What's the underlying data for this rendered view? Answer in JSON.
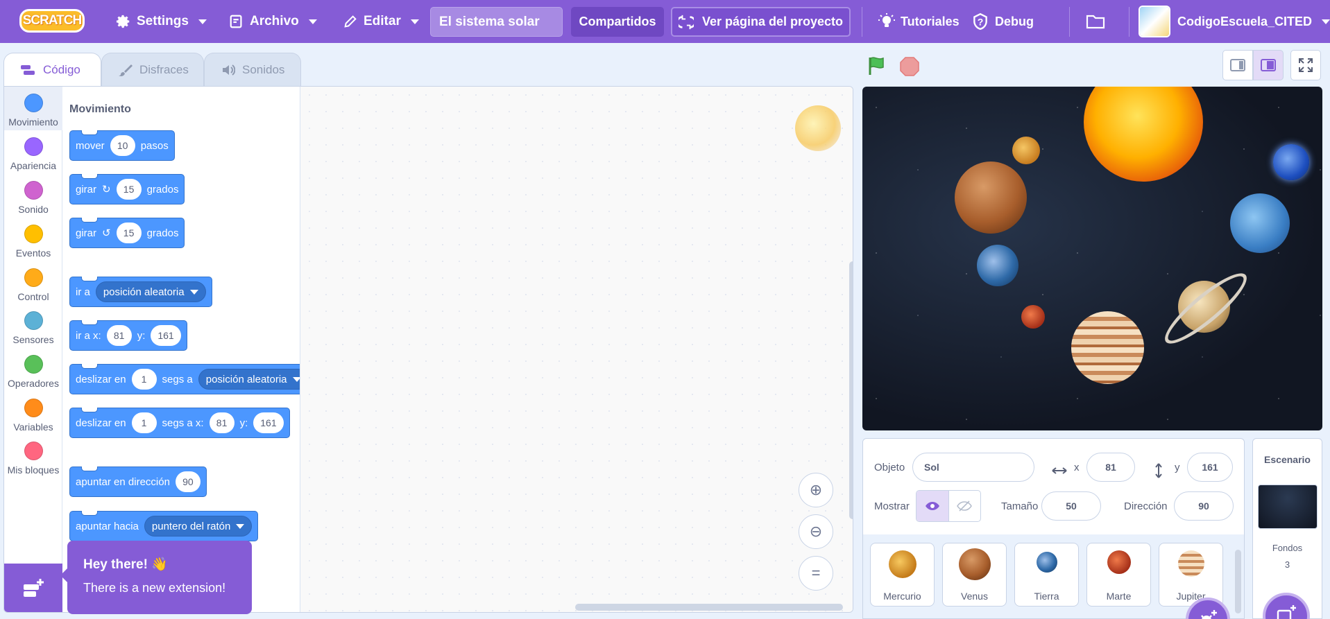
{
  "menu": {
    "logo": "SCRATCH",
    "settings": "Settings",
    "file": "Archivo",
    "edit": "Editar",
    "project_title": "El sistema solar",
    "share": "Compartidos",
    "see_project": "Ver página del proyecto",
    "tutorials": "Tutoriales",
    "debug": "Debug",
    "username": "CodigoEscuela_CITED"
  },
  "tabs": [
    "Código",
    "Disfraces",
    "Sonidos"
  ],
  "categories": [
    "Movimiento",
    "Apariencia",
    "Sonido",
    "Eventos",
    "Control",
    "Sensores",
    "Operadores",
    "Variables",
    "Mis bloques"
  ],
  "category_colors": [
    "#4c97ff",
    "#9966ff",
    "#cf63cf",
    "#ffbf00",
    "#ffab19",
    "#5cb1d6",
    "#59c059",
    "#ff8c1a",
    "#ff6680"
  ],
  "palette": {
    "title": "Movimiento",
    "b1": {
      "t1": "mover",
      "v": "10",
      "t2": "pasos"
    },
    "b2": {
      "t1": "girar",
      "v": "15",
      "t2": "grados"
    },
    "b3": {
      "t1": "girar",
      "v": "15",
      "t2": "grados"
    },
    "b4": {
      "t1": "ir a",
      "dd": "posición aleatoria"
    },
    "b5": {
      "t1": "ir a x:",
      "x": "81",
      "t2": "y:",
      "y": "161"
    },
    "b6": {
      "t1": "deslizar en",
      "v": "1",
      "t2": "segs a",
      "dd": "posición aleatoria"
    },
    "b7": {
      "t1": "deslizar en",
      "v": "1",
      "t2": "segs a x:",
      "x": "81",
      "t3": "y:",
      "y": "161"
    },
    "b8": {
      "t1": "apuntar en dirección",
      "v": "90"
    },
    "b9": {
      "t1": "apuntar hacia",
      "dd": "puntero del ratón"
    }
  },
  "tooltip": {
    "title": "Hey there! 👋",
    "body": "There is a new extension!"
  },
  "sprite_info": {
    "object_label": "Objeto",
    "object_name": "Sol",
    "x_label": "x",
    "x_value": "81",
    "y_label": "y",
    "y_value": "161",
    "show_label": "Mostrar",
    "size_label": "Tamaño",
    "size_value": "50",
    "direction_label": "Dirección",
    "direction_value": "90"
  },
  "sprites": [
    "Mercurio",
    "Venus",
    "Tierra",
    "Marte",
    "Jupiter"
  ],
  "stage_panel": {
    "title": "Escenario",
    "backdrops_label": "Fondos",
    "backdrops_count": "3"
  }
}
